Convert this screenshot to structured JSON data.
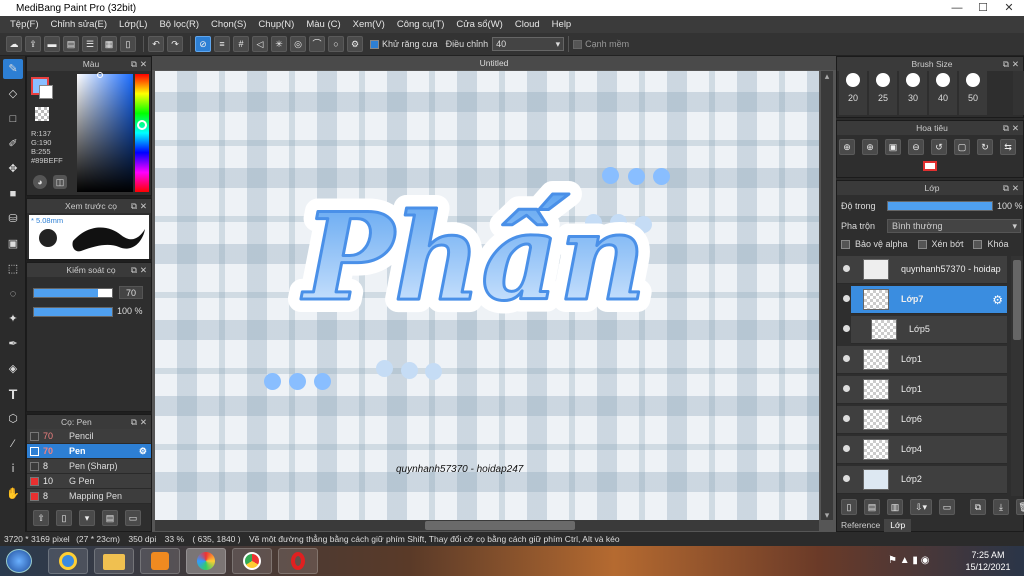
{
  "window": {
    "title": "MediBang Paint Pro (32bit)",
    "minimize": "—",
    "maximize": "☐",
    "close": "✕"
  },
  "menu": [
    "Tệp(F)",
    "Chỉnh sửa(E)",
    "Lớp(L)",
    "Bộ lọc(R)",
    "Chọn(S)",
    "Chụp(N)",
    "Màu (C)",
    "Xem(V)",
    "Công cụ(T)",
    "Cửa sổ(W)",
    "Cloud",
    "Help"
  ],
  "toolbar": {
    "antialias": "Khử răng cưa",
    "adjust": "Điều chỉnh",
    "adjust_value": "40",
    "snap": "Cạnh mềm"
  },
  "color_panel": {
    "title": "Màu",
    "r": "R:137",
    "g": "G:190",
    "b": "B:255",
    "hex": "#89BEFF",
    "fg_color": "#89BEFF"
  },
  "preview_panel": {
    "title": "Xem trước cọ",
    "size": "* 5.08mm"
  },
  "control_panel": {
    "title": "Kiểm soát cọ",
    "size": "70",
    "opacity": "100 %"
  },
  "brush_panel": {
    "title": "Cọ: Pen",
    "items": [
      {
        "size": "70",
        "name": "Pencil",
        "color": "#3a3a3a"
      },
      {
        "size": "70",
        "name": "Pen",
        "color": "#2d7fd4"
      },
      {
        "size": "8",
        "name": "Pen (Sharp)",
        "color": "#3a3a3a"
      },
      {
        "size": "10",
        "name": "G Pen",
        "color": "#e83030"
      },
      {
        "size": "8",
        "name": "Mapping Pen",
        "color": "#e83030"
      }
    ]
  },
  "canvas": {
    "title": "Untitled",
    "main_text": "Phấn",
    "signature": "quynhanh57370 - hoidap247"
  },
  "brushsize_panel": {
    "title": "Brush Size",
    "sizes": [
      "20",
      "25",
      "30",
      "40",
      "50"
    ]
  },
  "navigator_panel": {
    "title": "Hoa tiêu"
  },
  "layer_panel": {
    "title": "Lớp",
    "opacity_label": "Độ trong",
    "opacity_value": "100 %",
    "blend_label": "Pha trộn",
    "blend_value": "Bình thường",
    "protect_alpha": "Bảo vệ alpha",
    "clip": "Xén bớt",
    "lock": "Khóa",
    "layers": [
      "quynhanh57370 - hoidap",
      "Lớp7",
      "Lớp5",
      "Lớp1",
      "Lớp1",
      "Lớp6",
      "Lớp4",
      "Lớp2"
    ]
  },
  "right_tabs": {
    "reference": "Reference",
    "layer": "Lớp"
  },
  "status": {
    "size": "3720 * 3169 pixel",
    "physical": "(27 * 23cm)",
    "dpi": "350 dpi",
    "zoom": "33 %",
    "coords": "( 635, 1840 )",
    "hint": "Vẽ một đường thẳng bằng cách giữ phím Shift, Thay đổi cỡ cọ bằng cách giữ phím Ctrl, Alt và kéo"
  },
  "taskbar": {
    "time": "7:25 AM",
    "date": "15/12/2021"
  }
}
